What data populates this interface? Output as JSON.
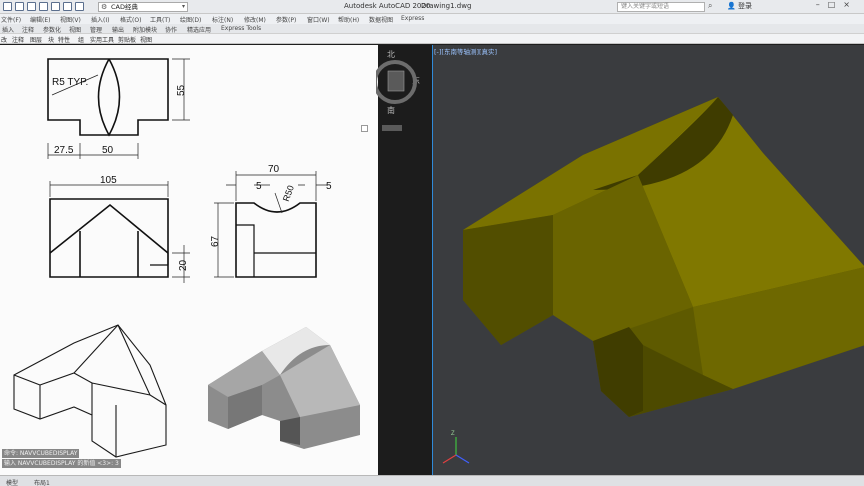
{
  "titlebar": {
    "workspace": "CAD经典",
    "app_title": "Autodesk AutoCAD 2020",
    "file_title": "Drawing1.dwg",
    "help_placeholder": "键入关键字或短语",
    "login": "登录"
  },
  "menubar": {
    "items": [
      "文件(F)",
      "编辑(E)",
      "视图(V)",
      "插入(I)",
      "格式(O)",
      "工具(T)",
      "绘图(D)",
      "标注(N)",
      "修改(M)",
      "参数(P)",
      "窗口(W)",
      "帮助(H)",
      "数据视图",
      "Express"
    ]
  },
  "ribbon_tabs": {
    "items": [
      "插入",
      "注释",
      "参数化",
      "视图",
      "管理",
      "输出",
      "附加模块",
      "协作",
      "精选应用",
      "Express Tools"
    ]
  },
  "panelbar": {
    "items": [
      "改",
      "注释",
      "图层",
      "块",
      "特性",
      "组",
      "实用工具",
      "剪贴板",
      "视图"
    ]
  },
  "reference_drawing": {
    "labels": {
      "r5": "R5 TYP.",
      "d55": "55",
      "d27_5": "27.5",
      "d50": "50",
      "d105": "105",
      "d20": "20",
      "d70": "70",
      "d5a": "5",
      "d5b": "5",
      "r50": "R50",
      "d67": "67"
    }
  },
  "command_history": {
    "lines": [
      "命令: NAVVCUBEDISPLAY",
      "输入 NAVVCUBEDISPLAY 的新值 <3>: 3"
    ]
  },
  "viewport": {
    "label": "[-][东南等轴测][真实]",
    "model_color": "#5e5a00"
  },
  "viewcube": {
    "north": "北",
    "east": "东",
    "south": "南"
  },
  "statusbar": {
    "model_tab": "模型",
    "layout_tab": "布局1"
  }
}
